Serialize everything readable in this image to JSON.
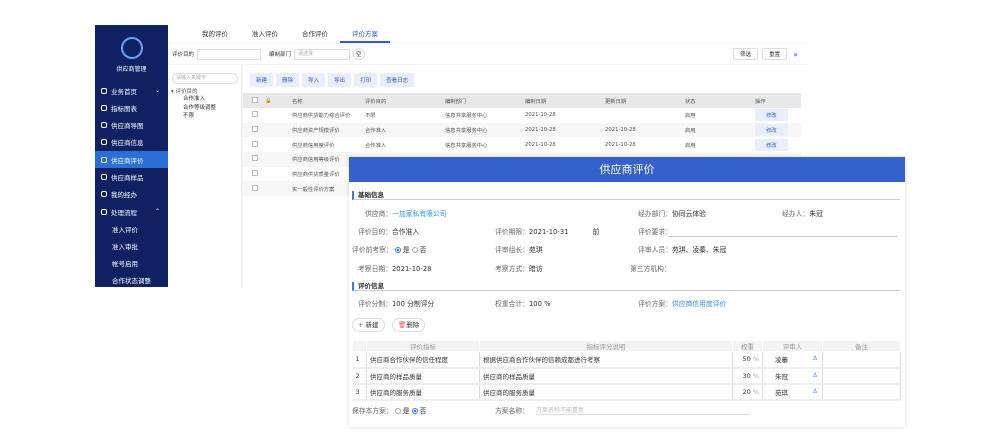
{
  "sidebar": {
    "title": "供应商管理",
    "items": [
      {
        "label": "业务首页"
      },
      {
        "label": "指标图表"
      },
      {
        "label": "供应商导图"
      },
      {
        "label": "供应商信息"
      },
      {
        "label": "供应商评价"
      },
      {
        "label": "供应商样品"
      },
      {
        "label": "我的经办"
      },
      {
        "label": "处理流程"
      },
      {
        "label": "准入评价"
      },
      {
        "label": "准入审批"
      },
      {
        "label": "帐号启用"
      },
      {
        "label": "合作状态调整"
      }
    ]
  },
  "tabs": [
    "我的评价",
    "准入评价",
    "合作评价",
    "评价方案"
  ],
  "filter": {
    "purpose_label": "评价目的",
    "dept_label": "编制部门",
    "dept_placeholder": "请选择",
    "clear": "空",
    "filter_btn": "筛选",
    "reset_btn": "重置",
    "expand": "»"
  },
  "tree": {
    "search_placeholder": "请输入关键字",
    "root": "评价目的",
    "children": [
      "合作准入",
      "合作等级调整",
      "不限"
    ]
  },
  "toolbar": [
    "新建",
    "删除",
    "导入",
    "导出",
    "打印",
    "查看日志"
  ],
  "grid": {
    "headers": [
      "名称",
      "评价目的",
      "编制部门",
      "编制日期",
      "更新日期",
      "状态",
      "操作"
    ],
    "rows": [
      [
        "供应商供货能力综合评价",
        "不限",
        "信息共享服务中心",
        "2021-10-28",
        "",
        "启用",
        "修改"
      ],
      [
        "供应商资产规模评价",
        "合作准入",
        "信息共享服务中心",
        "2021-10-28",
        "2021-10-28",
        "启用",
        "修改"
      ],
      [
        "供应商信用度评价",
        "合作准入",
        "信息共享服务中心",
        "2021-10-28",
        "2021-10-28",
        "启用",
        "修改"
      ],
      [
        "供应商信用等级评价",
        "",
        "",
        "",
        "",
        "",
        ""
      ],
      [
        "供应商供货质量评价",
        "",
        "",
        "",
        "",
        "",
        ""
      ],
      [
        "实一般性评价方案",
        "",
        "",
        "",
        "",
        "",
        ""
      ]
    ]
  },
  "modal": {
    "title": "供应商评价",
    "basic": "基础信息",
    "supplier_l": "供应商：",
    "supplier": "一加家私有限公司",
    "dept_l": "经办部门：",
    "dept": "协同云体验",
    "handler_l": "经办人：",
    "handler": "朱冠",
    "purpose_l": "评价目的：",
    "purpose": "合作准入",
    "deadline_l": "评价期限：",
    "deadline": "2021-10-31",
    "before": "前",
    "req_l": "评价要求：",
    "pre_l": "评价前考察：",
    "yes": "是",
    "no": "否",
    "leader_l": "评审组长：",
    "leader": "苑琪",
    "reviewers_l": "评审人员：",
    "reviewers": "苑琪、凌蓁、朱冠",
    "date_l": "考察日期：",
    "date": "2021-10-28",
    "method_l": "考察方式：",
    "method": "暗访",
    "third_l": "第三方机构：",
    "eval": "评价信息",
    "score_l": "评价分制：",
    "score": "100 分制评分",
    "weight_l": "权重合计：",
    "weight": "100 %",
    "plan_l": "评价方案：",
    "plan": "供应商信用度评价",
    "new": "新建",
    "del": "删除",
    "headers": [
      "评价指标",
      "指标评分说明",
      "权重",
      "评审人",
      "备注"
    ],
    "rows": [
      {
        "n": "1",
        "ind": "供应商合作伙伴的信任程度",
        "desc": "根据供应商合作伙伴的信赖成都进行考察",
        "w": "50",
        "p": "%",
        "r": "凌蓁"
      },
      {
        "n": "2",
        "ind": "供应商的样品质量",
        "desc": "供应商的样品质量",
        "w": "30",
        "p": "%",
        "r": "朱冠"
      },
      {
        "n": "3",
        "ind": "供应商的服务质量",
        "desc": "供应商的服务质量",
        "w": "20",
        "p": "%",
        "r": "苑琪"
      }
    ],
    "save_l": "保存本方案：",
    "name_l": "方案名称：",
    "name_placeholder": "方案名称不能重复"
  }
}
